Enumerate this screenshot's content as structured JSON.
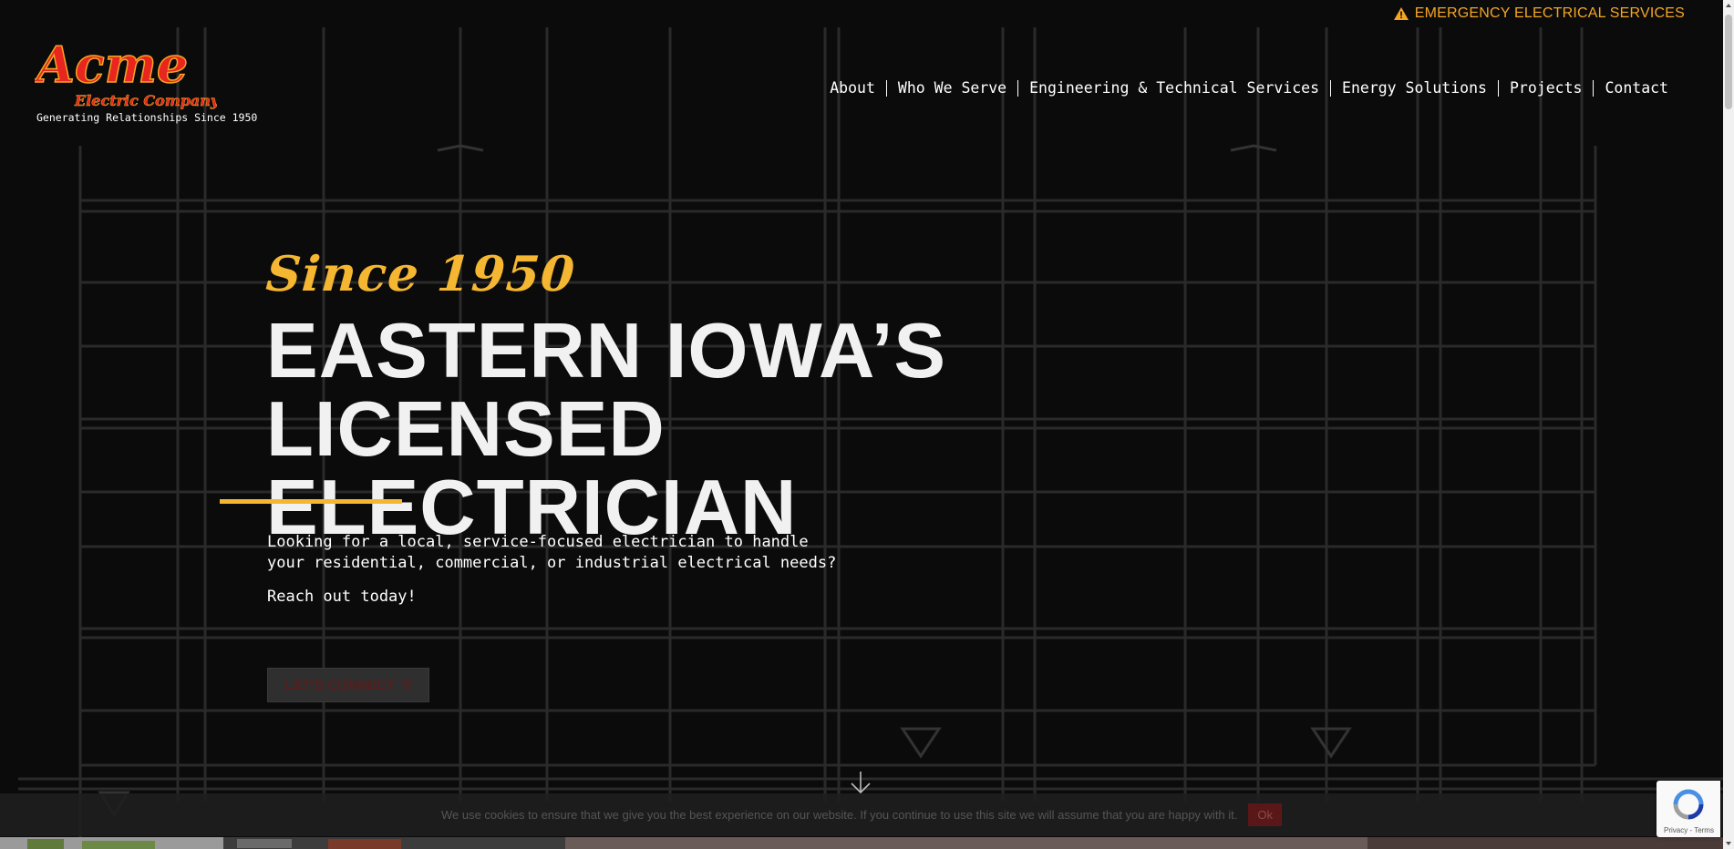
{
  "header": {
    "emergency_label": "EMERGENCY ELECTRICAL SERVICES",
    "logo_brand": "Acme",
    "logo_sub": "Electric Company",
    "logo_tagline": "Generating Relationships Since 1950"
  },
  "nav": {
    "items": [
      {
        "label": "About"
      },
      {
        "label": "Who We Serve"
      },
      {
        "label": "Engineering & Technical Services"
      },
      {
        "label": "Energy Solutions"
      },
      {
        "label": "Projects"
      },
      {
        "label": "Contact"
      }
    ]
  },
  "hero": {
    "since": "Since 1950",
    "headline_line1": "EASTERN IOWA’S LICENSED",
    "headline_line2": "ELECTRICIAN",
    "lead": "Looking for a local, service-focused electrician to handle your residential, commercial, or industrial electrical needs?",
    "reach": "Reach out today!",
    "cta_label": "LET'S CONNECT"
  },
  "cookie": {
    "message": "We use cookies to ensure that we give you the best experience on our website. If you continue to use this site we will assume that you are happy with it.",
    "ok_label": "Ok"
  },
  "recaptcha": {
    "links": "Privacy - Terms"
  },
  "colors": {
    "accent": "#f5b731",
    "emergency": "#f5a623",
    "logo_red": "#e8261f",
    "background": "#0b0b0b"
  }
}
